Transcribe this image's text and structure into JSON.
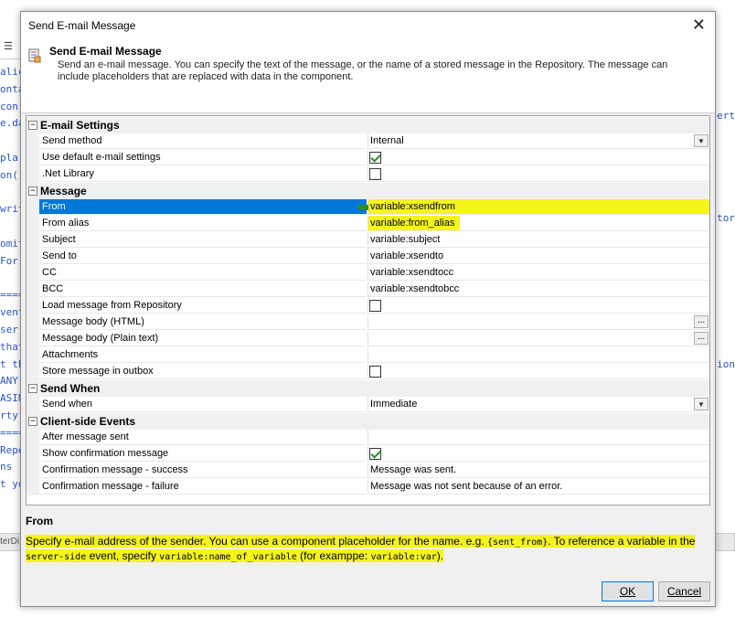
{
  "background": {
    "left_fragments": [
      "alic",
      "onta",
      " con",
      "e.da",
      "",
      " pla",
      "on('",
      "",
      "writ",
      "",
      "omit",
      " For",
      "",
      "====",
      "vent",
      "ser)",
      "that",
      "t th",
      "ANY ",
      "ASIN",
      "rty",
      "====",
      "Repe",
      "ns ",
      "t yo"
    ],
    "right_fragments": [
      "ert",
      "tor",
      "ion"
    ],
    "status_label": "terDi"
  },
  "dialog": {
    "title": "Send E-mail Message",
    "close_glyph": "✕",
    "header_title": "Send E-mail Message",
    "header_description": "Send an e-mail message. You can specify the text of the message, or the name of a stored message in the Repository. The message can include placeholders that are replaced with data in the component.",
    "categories": {
      "email_settings": "E-mail Settings",
      "message": "Message",
      "send_when": "Send When",
      "client_events": "Client-side Events"
    },
    "props": {
      "send_method": {
        "name": "Send method",
        "value": "Internal"
      },
      "use_default": {
        "name": "Use default e-mail settings",
        "checked": true
      },
      "net_library": {
        "name": ".Net Library",
        "checked": false
      },
      "from": {
        "name": "From",
        "value": "variable:xsendfrom"
      },
      "from_alias": {
        "name": "From alias",
        "value": "variable:from_alias"
      },
      "subject": {
        "name": "Subject",
        "value": "variable:subject"
      },
      "send_to": {
        "name": "Send to",
        "value": "variable:xsendto"
      },
      "cc": {
        "name": "CC",
        "value": "variable:xsendtocc"
      },
      "bcc": {
        "name": "BCC",
        "value": "variable:xsendtobcc"
      },
      "load_repo": {
        "name": "Load message from Repository",
        "checked": false
      },
      "body_html": {
        "name": "Message body (HTML)",
        "value": ""
      },
      "body_plain": {
        "name": "Message body (Plain text)",
        "value": ""
      },
      "attachments": {
        "name": "Attachments",
        "value": ""
      },
      "store_outbox": {
        "name": "Store message in outbox",
        "checked": false
      },
      "send_when": {
        "name": "Send when",
        "value": "Immediate"
      },
      "after_sent": {
        "name": "After message sent",
        "value": ""
      },
      "show_confirm": {
        "name": "Show confirmation message",
        "checked": true
      },
      "confirm_success": {
        "name": "Confirmation message - success",
        "value": "Message was sent."
      },
      "confirm_failure": {
        "name": "Confirmation message - failure",
        "value": "Message was not sent because of an error."
      }
    },
    "ellipsis_glyph": "...",
    "dropdown_glyph": "▼",
    "toggle_glyph": "−",
    "description": {
      "title": "From",
      "part1": "Specify e-mail address of the sender. You can use a component placeholder for the name. e.g. ",
      "code1": "{sent_from}",
      "part2": ". To reference a variable in the ",
      "code2": "server-side",
      "part3": " event, specify ",
      "code3": "variable:name_of_variable",
      "part4": " (for examppe: ",
      "code4": "variable:var",
      "part5": ")."
    },
    "buttons": {
      "ok": "OK",
      "cancel": "Cancel"
    },
    "colors": {
      "selection": "#0078d7",
      "highlight": "#f4f51a",
      "check": "#2e8b2e"
    }
  }
}
